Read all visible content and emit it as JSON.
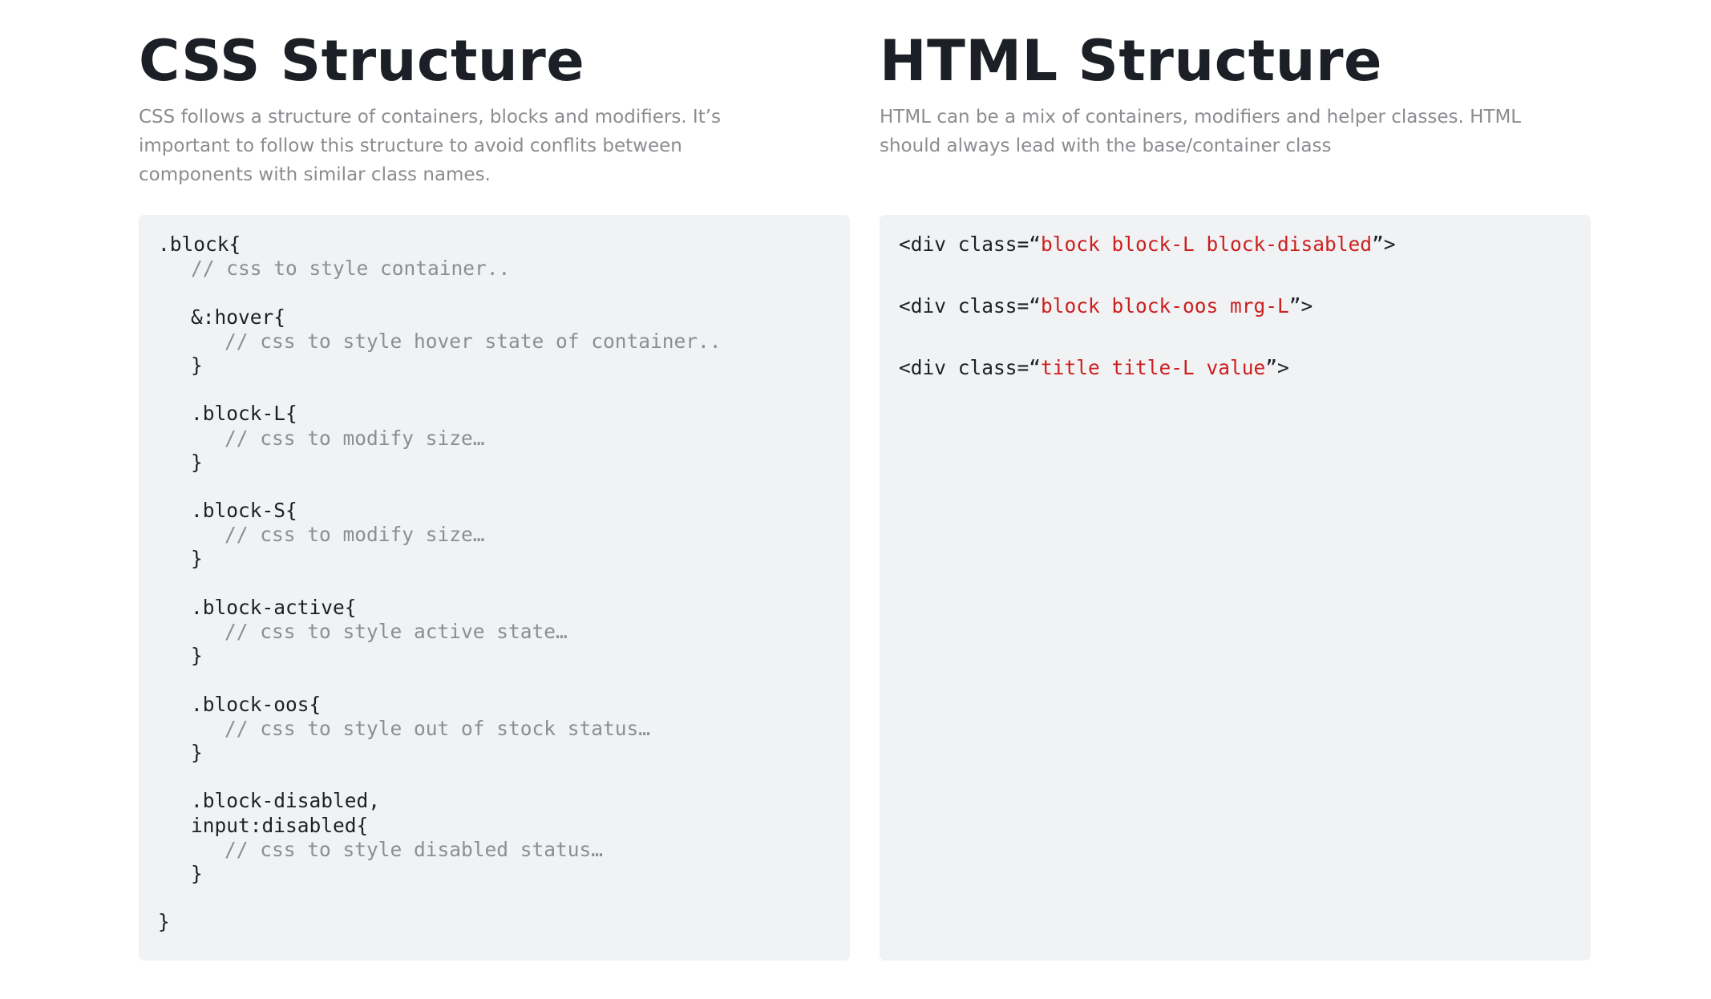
{
  "css_section": {
    "title": "CSS Structure",
    "description_lines": [
      "CSS follows a structure of containers, blocks and modifiers. It’s",
      "important to follow this structure to avoid conflits between",
      "components with similar class names."
    ],
    "code_lines": [
      ".block{",
      "// css to style container..",
      "",
      "&:hover{",
      "// css to style hover state of container..",
      "}",
      "",
      ".block-L{",
      "// css to modify size…",
      "}",
      "",
      ".block-S{",
      "// css to modify size…",
      "}",
      "",
      ".block-active{",
      "// css to style active state…",
      "}",
      "",
      ".block-oos{",
      "// css to style out of stock status…",
      "}",
      "",
      ".block-disabled,",
      "input:disabled{",
      "// css to style disabled status…",
      "}",
      "",
      "}"
    ]
  },
  "html_section": {
    "title": "HTML Structure",
    "description_lines": [
      "HTML can be a mix of containers, modifiers and helper classes. HTML",
      "should always lead with the base/container class"
    ],
    "code_lines": [
      {
        "prefix": "<div class=“",
        "classes": "block block-L block-disabled",
        "suffix": "”>"
      },
      {
        "prefix": "<div class=“",
        "classes": "block block-oos mrg-L",
        "suffix": "”>"
      },
      {
        "prefix": "<div class=“",
        "classes": "title title-L value",
        "suffix": "”>"
      }
    ]
  },
  "colors": {
    "heading": "#1c2026",
    "description": "#8a8c90",
    "panel_background": "#f1f2f4",
    "code_text": "#1c2026",
    "code_comment": "#8c8e92",
    "class_value": "#cc1f1f"
  }
}
